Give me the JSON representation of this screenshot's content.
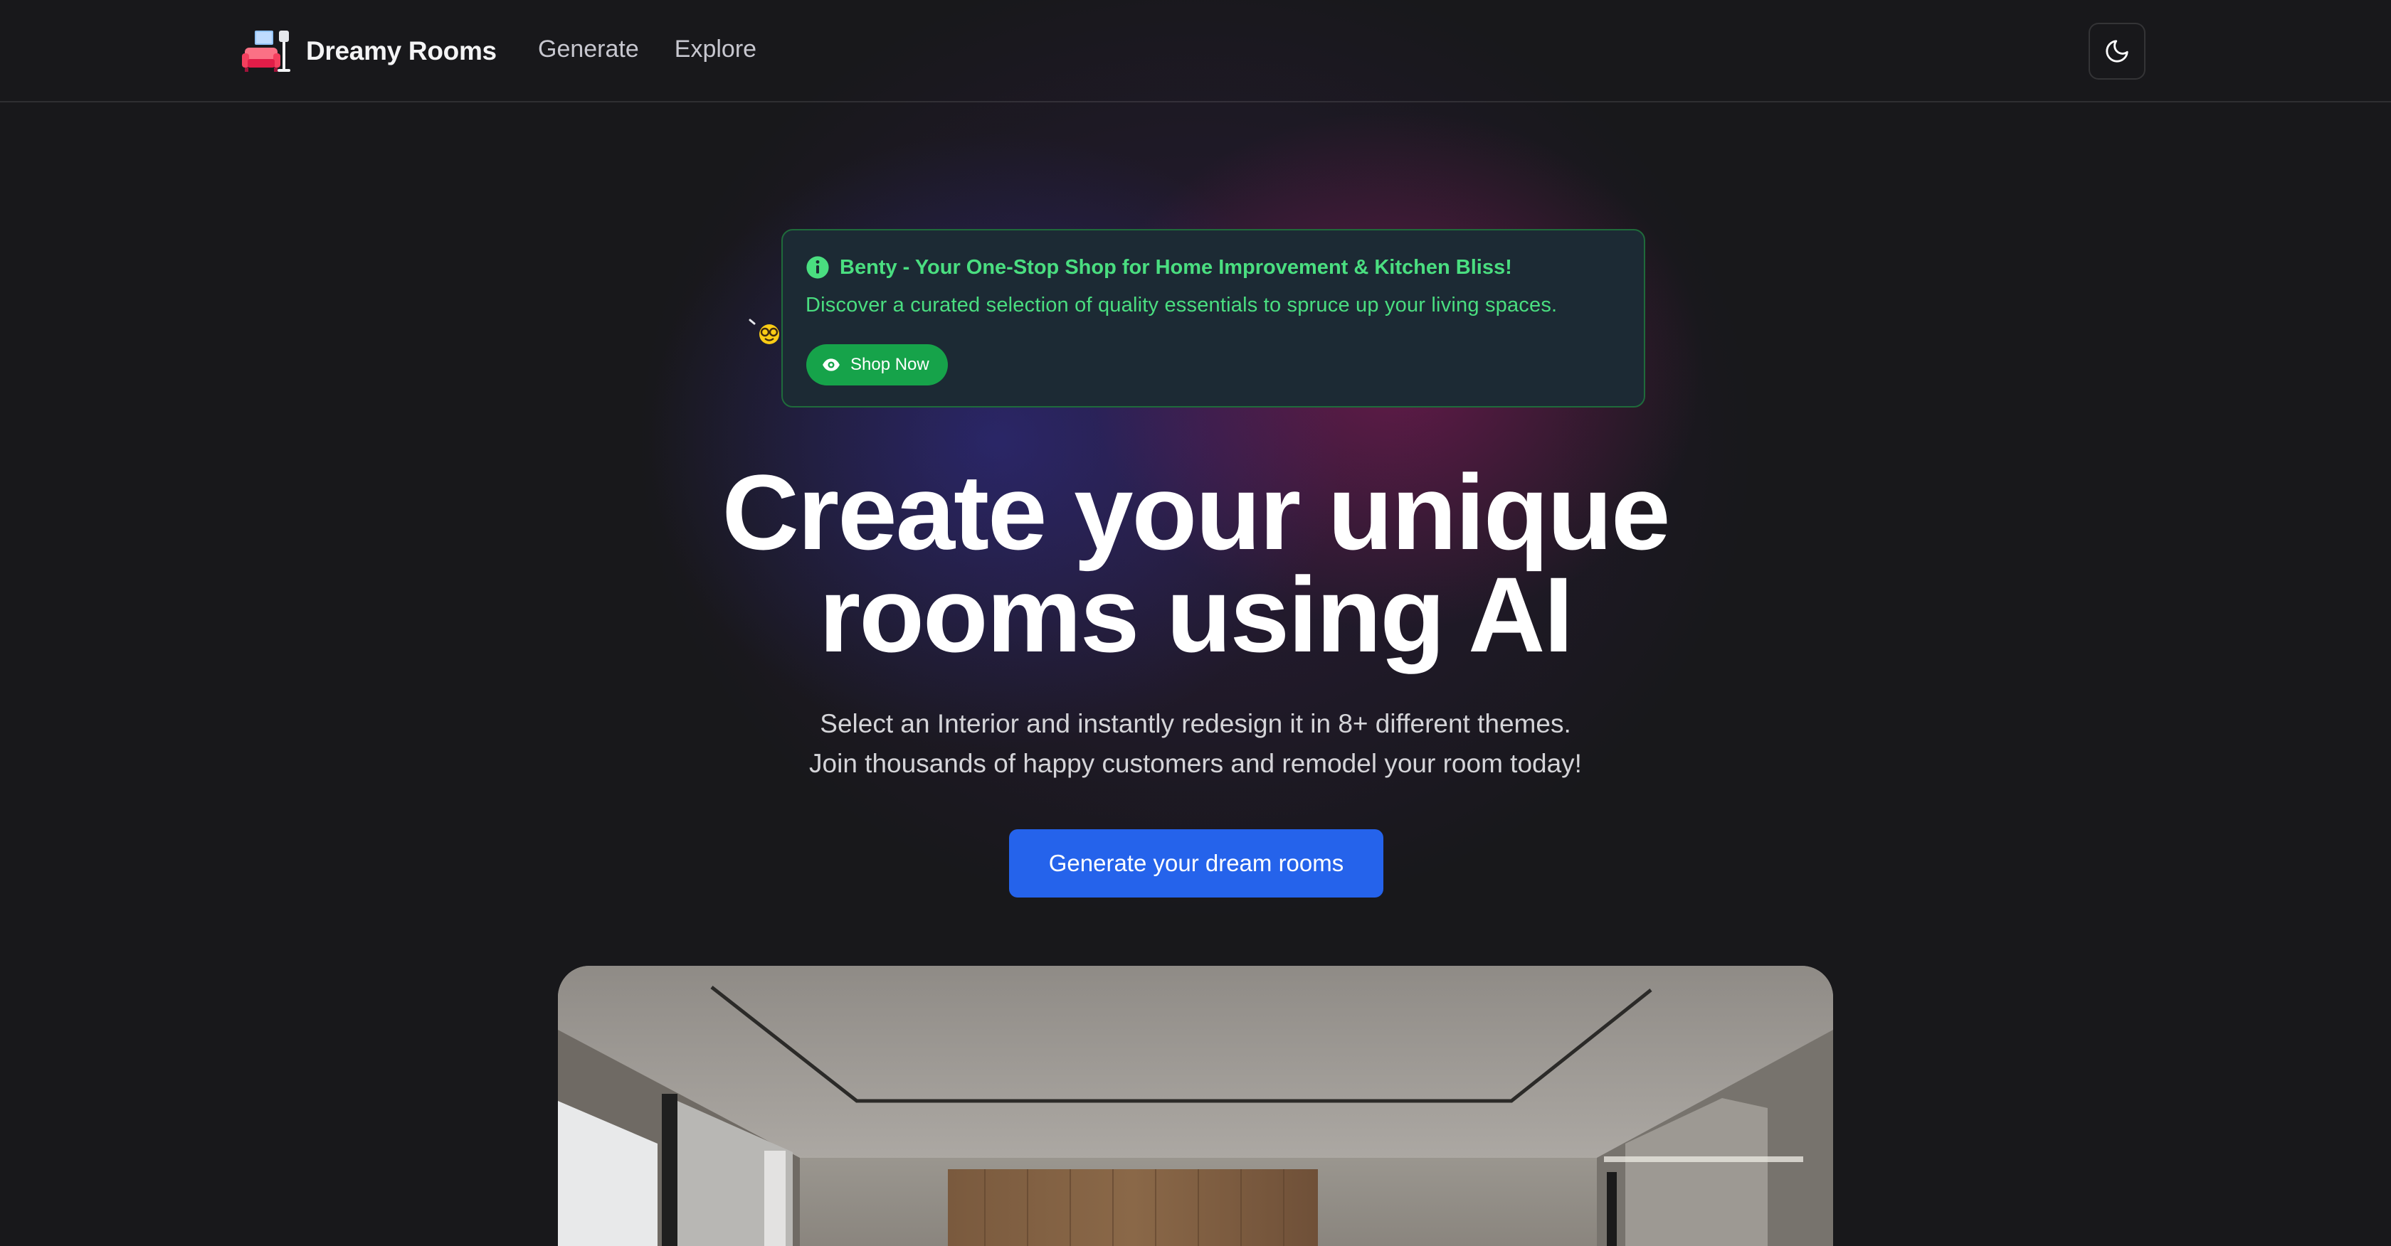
{
  "header": {
    "brand": "Dreamy Rooms",
    "nav": [
      {
        "label": "Generate"
      },
      {
        "label": "Explore"
      }
    ],
    "theme_toggle_icon": "moon-icon"
  },
  "promo": {
    "title": "Benty - Your One-Stop Shop for Home Improvement & Kitchen Bliss!",
    "description": "Discover a curated selection of quality essentials to spruce up your living spaces.",
    "button_label": "Shop Now",
    "accent_color": "#4ade80",
    "button_color": "#16a34a"
  },
  "hero": {
    "title_line1": "Create your unique",
    "title_line2": "rooms using AI",
    "subtitle_line1": "Select an Interior and instantly redesign it in 8+ different themes.",
    "subtitle_line2": "Join thousands of happy customers and remodel your room today!",
    "cta_label": "Generate your dream rooms",
    "cta_color": "#2563eb"
  },
  "colors": {
    "background": "#18181b"
  }
}
